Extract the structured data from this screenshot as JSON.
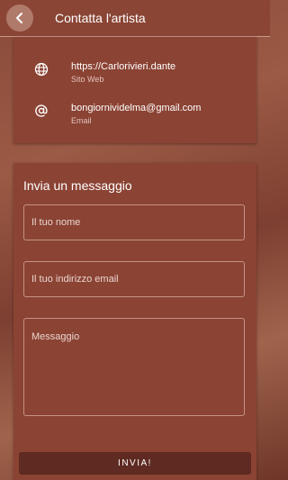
{
  "header": {
    "title": "Contatta l'artista",
    "back_icon": "chevron-left-icon"
  },
  "contacts": [
    {
      "icon": "globe-icon",
      "value": "https://Carlorivieri.dante",
      "label": "Sito Web"
    },
    {
      "icon": "at-sign-icon",
      "value": "bongiornividelma@gmail.com",
      "label": "Email"
    }
  ],
  "form": {
    "title": "Invia un messaggio",
    "name_placeholder": "Il tuo nome",
    "email_placeholder": "Il tuo indirizzo email",
    "message_placeholder": "Messaggio",
    "name_value": "",
    "email_value": "",
    "message_value": "",
    "submit_label": "INVIA!"
  },
  "colors": {
    "appbar": "#8a4535",
    "card": "#8b4334",
    "button": "#5e2a21",
    "field_border": "#c49384"
  }
}
